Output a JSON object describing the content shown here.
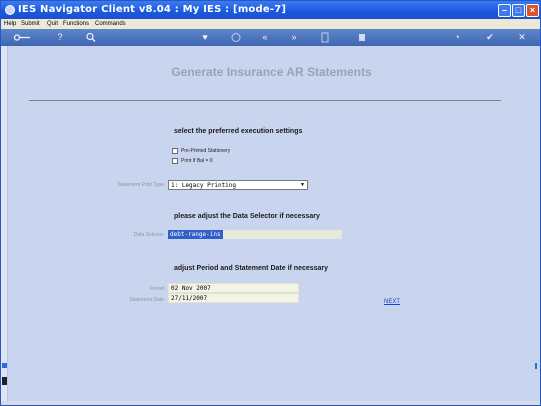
{
  "window": {
    "title": "IES Navigator Client v8.04 : My IES :      [mode-7]",
    "controls": {
      "minimize": "–",
      "maximize": "□",
      "close": "×"
    }
  },
  "menubar": {
    "items": [
      "Help",
      "Submit",
      "Quit",
      "Functions",
      "Commands"
    ]
  },
  "toolbar": {
    "icons": [
      "key-icon",
      "help-icon",
      "search-icon",
      "heart-icon",
      "clock-icon",
      "back-icon",
      "forward-icon",
      "page-icon",
      "list-icon",
      "settings-icon",
      "check-icon",
      "close-icon"
    ]
  },
  "form": {
    "title": "Generate Insurance AR Statements",
    "sections": {
      "execution": "select the preferred execution settings",
      "data_selector": "please adjust the Data Selector if necessary",
      "period": "adjust Period and Statement Date if necessary"
    },
    "options": {
      "pre_printed": {
        "label": "Pre-Printed Stationery",
        "checked": false
      },
      "print_if_bal_zero": {
        "label": "Print If Bal = 0",
        "checked": false
      }
    },
    "print_type": {
      "label": "Statement Print Type",
      "value": "1: Legacy Printing"
    },
    "data_selector": {
      "label": "Data Selector",
      "value": "debt-range-ins"
    },
    "period": {
      "label": "Period",
      "value": "02 Nov 2007"
    },
    "statement_date": {
      "label": "Statement Date",
      "value": "27/11/2007"
    },
    "next_link": "NEXT"
  },
  "colors": {
    "titlebar": "#1c5ae0",
    "background": "#c9d5ef",
    "link": "#2240c8",
    "selection": "#315fc8"
  }
}
